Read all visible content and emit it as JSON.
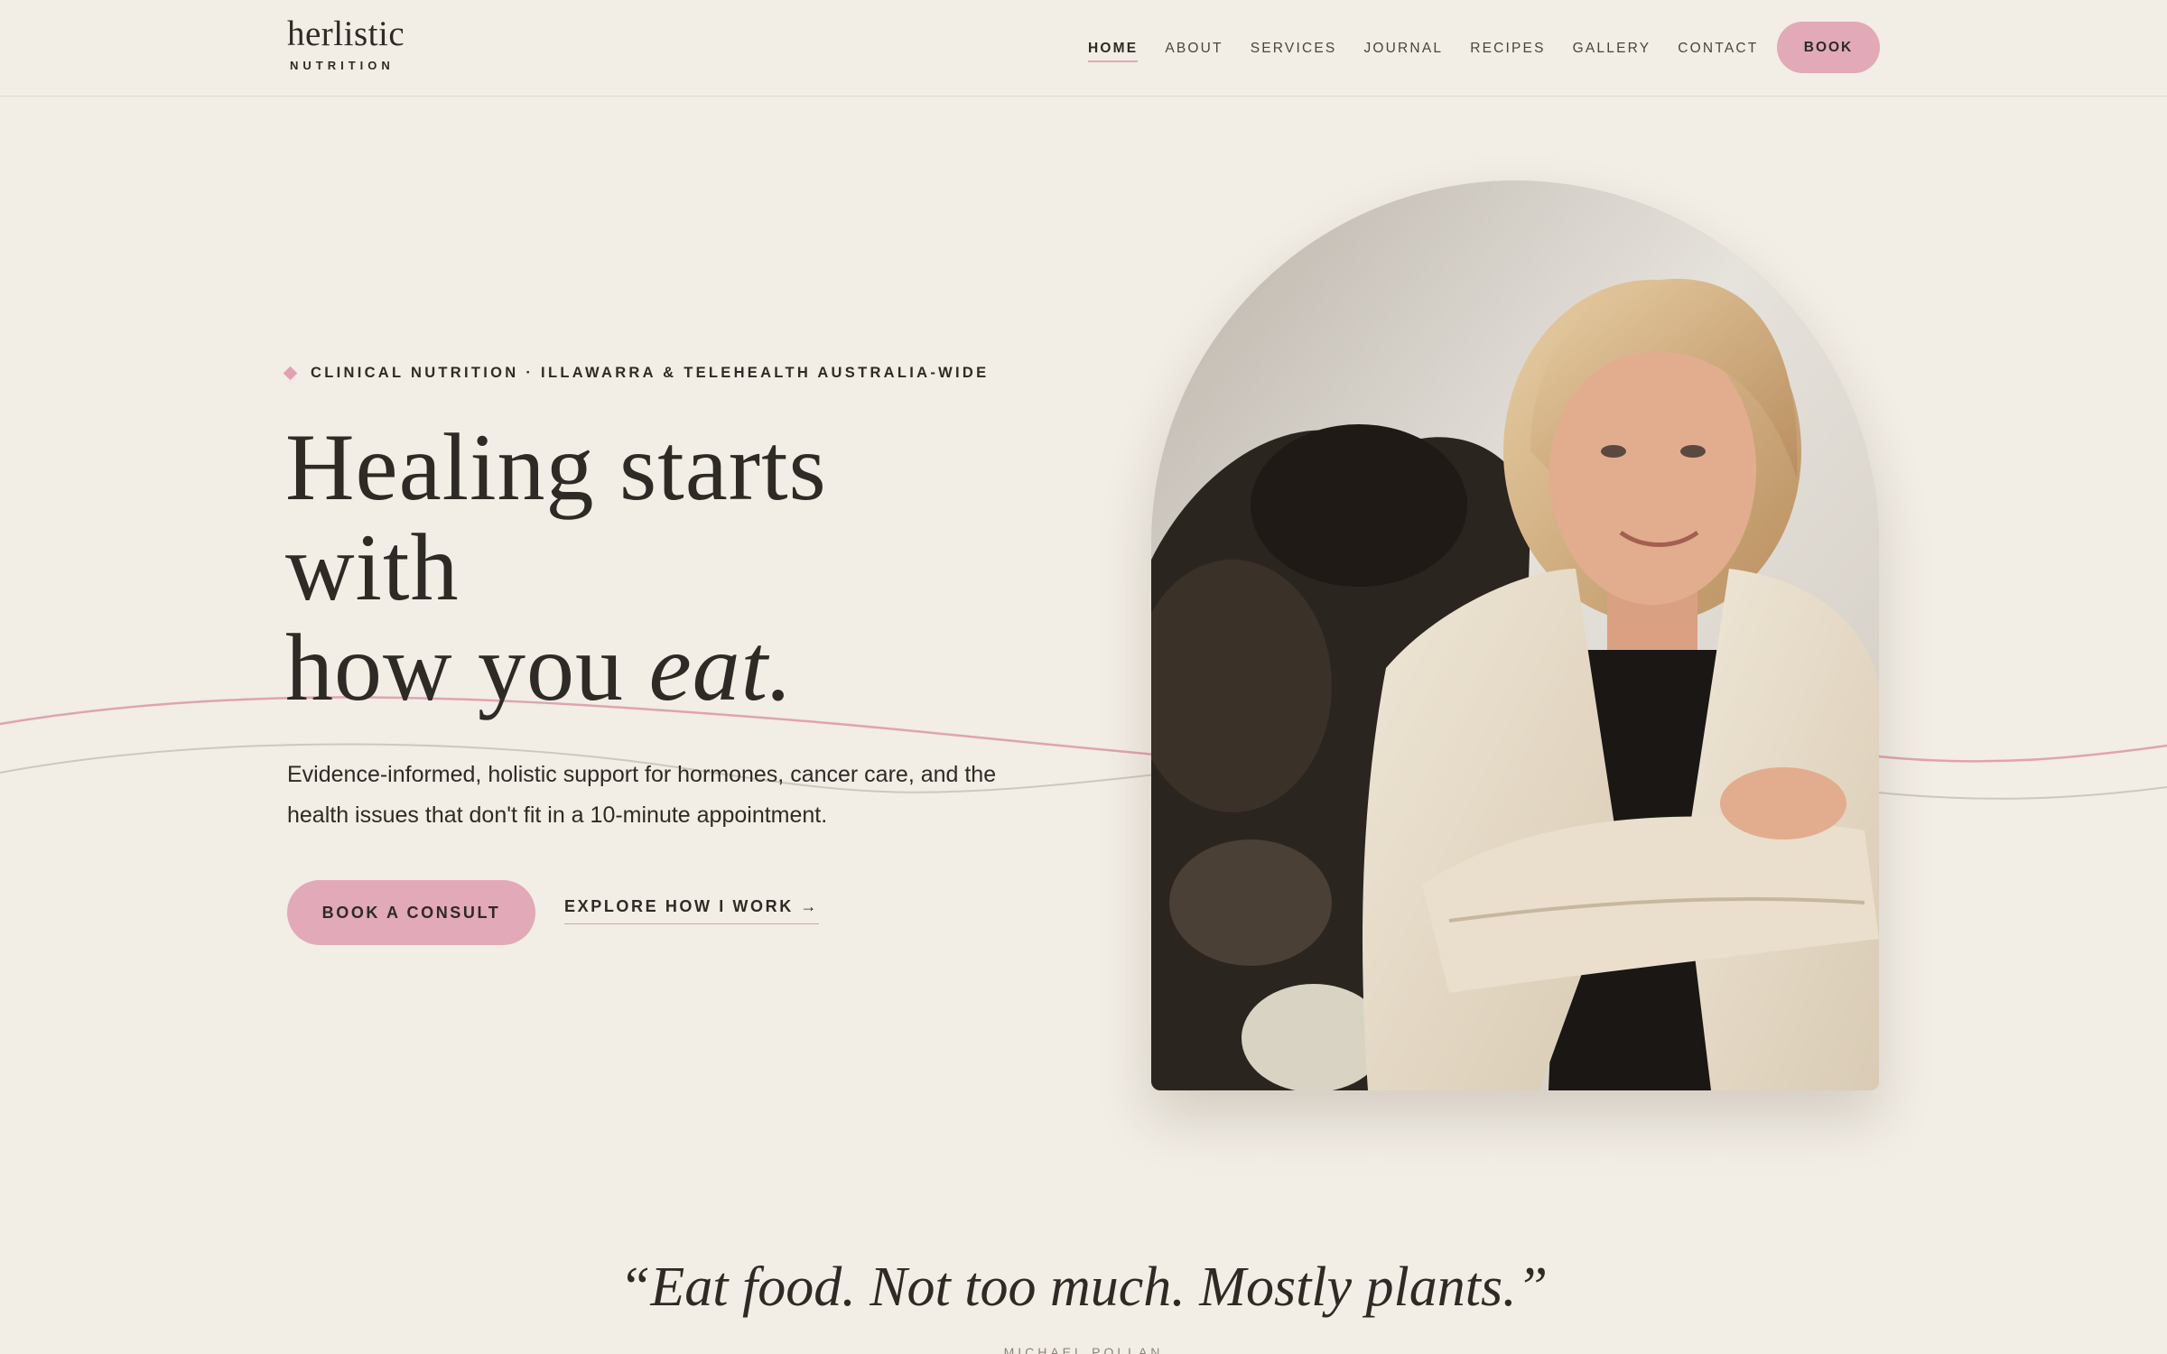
{
  "brand": {
    "name": "herlistic",
    "tagline": "NUTRITION"
  },
  "nav": {
    "items": [
      {
        "label": "HOME",
        "active": true
      },
      {
        "label": "ABOUT",
        "active": false
      },
      {
        "label": "SERVICES",
        "active": false
      },
      {
        "label": "JOURNAL",
        "active": false
      },
      {
        "label": "RECIPES",
        "active": false
      },
      {
        "label": "GALLERY",
        "active": false
      },
      {
        "label": "CONTACT",
        "active": false
      }
    ],
    "book_label": "BOOK"
  },
  "hero": {
    "eyebrow": "CLINICAL NUTRITION · ILLAWARRA & TELEHEALTH AUSTRALIA-WIDE",
    "headline_line1": "Healing starts",
    "headline_line2": "with",
    "headline_line3_plain": "how you ",
    "headline_line3_accent": "eat.",
    "lede": "Evidence-informed, holistic support for hormones, cancer care, and the health issues that don't fit in a 10-minute appointment.",
    "cta_primary": "BOOK A CONSULT",
    "cta_secondary": "EXPLORE HOW I WORK →"
  },
  "quote": {
    "text": "“Eat food. Not too much. Mostly plants.”",
    "author": "MICHAEL POLLAN"
  },
  "colors": {
    "background": "#f2ede5",
    "text": "#2e2a25",
    "accent_pink": "#e2a9b8",
    "wave_pink": "#dfa3b2",
    "wave_grey": "#cfc7be"
  },
  "icons": {
    "eyebrow_marker": "diamond-icon",
    "cta_arrow": "arrow-right-icon"
  }
}
